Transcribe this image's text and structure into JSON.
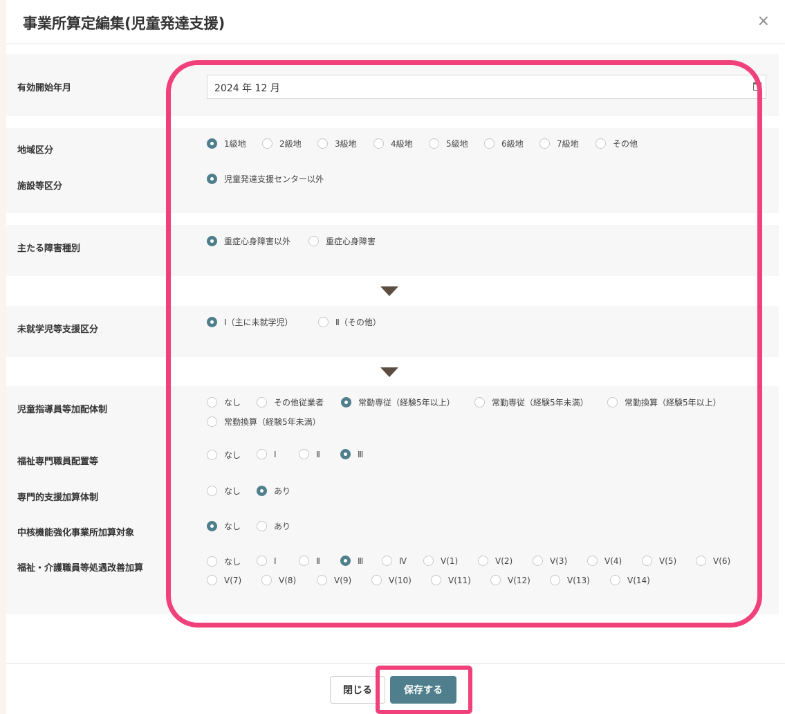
{
  "title": "事業所算定編集(児童発達支援)",
  "close_symbol": "×",
  "start_date": {
    "label": "有効開始年月",
    "value": "2024 年 12 月"
  },
  "area": {
    "label": "地域区分",
    "options": [
      "1級地",
      "2級地",
      "3級地",
      "4級地",
      "5級地",
      "6級地",
      "7級地",
      "その他"
    ],
    "selected": "1級地"
  },
  "facility": {
    "label": "施設等区分",
    "options": [
      "児童発達支援センター以外"
    ],
    "selected": "児童発達支援センター以外"
  },
  "disability": {
    "label": "主たる障害種別",
    "options": [
      "重症心身障害以外",
      "重症心身障害"
    ],
    "selected": "重症心身障害以外"
  },
  "preschool": {
    "label": "未就学児等支援区分",
    "options": [
      "Ⅰ（主に未就学児）",
      "Ⅱ（その他）"
    ],
    "selected": "Ⅰ（主に未就学児）"
  },
  "staff": {
    "label": "児童指導員等加配体制",
    "options": [
      "なし",
      "その他従業者",
      "常勤専従（経験5年以上）",
      "常勤専従（経験5年未満）",
      "常勤換算（経験5年以上）",
      "常勤換算（経験5年未満）"
    ],
    "selected": "常勤専従（経験5年以上）"
  },
  "welfare_staff": {
    "label": "福祉専門職員配置等",
    "options": [
      "なし",
      "Ⅰ",
      "Ⅱ",
      "Ⅲ"
    ],
    "selected": "Ⅲ"
  },
  "specialist": {
    "label": "専門的支援加算体制",
    "options": [
      "なし",
      "あり"
    ],
    "selected": "あり"
  },
  "core": {
    "label": "中核機能強化事業所加算対象",
    "options": [
      "なし",
      "あり"
    ],
    "selected": "なし"
  },
  "improvement": {
    "label": "福祉・介護職員等処遇改善加算",
    "options": [
      "なし",
      "Ⅰ",
      "Ⅱ",
      "Ⅲ",
      "Ⅳ",
      "Ⅴ(1)",
      "Ⅴ(2)",
      "Ⅴ(3)",
      "Ⅴ(4)",
      "Ⅴ(5)",
      "Ⅴ(6)",
      "Ⅴ(7)",
      "Ⅴ(8)",
      "Ⅴ(9)",
      "Ⅴ(10)",
      "Ⅴ(11)",
      "Ⅴ(12)",
      "Ⅴ(13)",
      "Ⅴ(14)"
    ],
    "selected": "Ⅲ"
  },
  "footer": {
    "close_label": "閉じる",
    "save_label": "保存する"
  },
  "colors": {
    "accent": "#4f7f8d",
    "highlight": "#f0417a",
    "arrow": "#5c4d40"
  }
}
